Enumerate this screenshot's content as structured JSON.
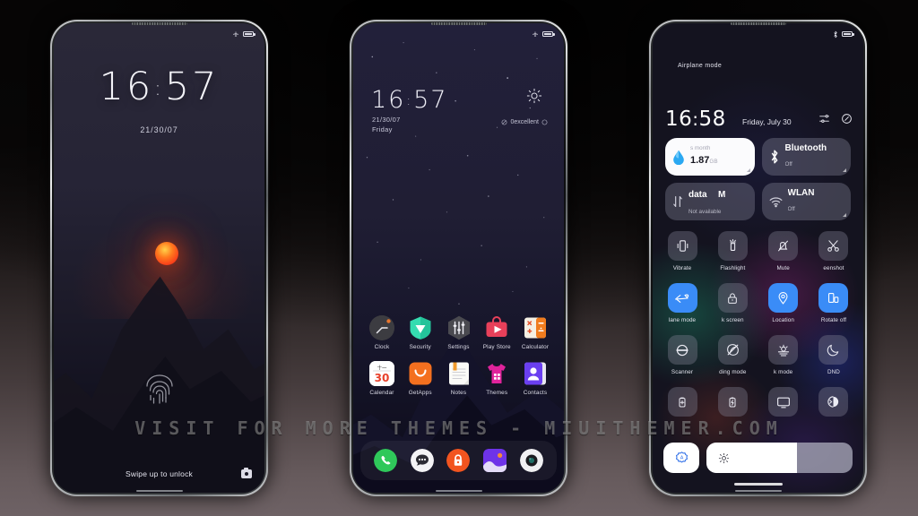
{
  "watermark": "VISIT FOR MORE THEMES - MIUITHEMER.COM",
  "colors": {
    "accent_blue": "#3a8cf7",
    "sun_orange": "#ff5a1e",
    "tile_grey": "#80808f",
    "screen_bg": "#1e1c2b"
  },
  "lock_screen": {
    "status": {
      "battery_icon": "battery-icon",
      "airplane_icon": "airplane-icon"
    },
    "time": "16",
    "time_minutes": "57",
    "time_separator": ":",
    "date": "21/30/07",
    "fingerprint_icon": "fingerprint-icon",
    "swipe_hint": "Swipe up to unlock",
    "camera_icon": "camera-icon"
  },
  "home_screen": {
    "status": {
      "battery_icon": "battery-icon",
      "airplane_icon": "airplane-icon"
    },
    "time": "16",
    "time_minutes": "57",
    "time_separator": ":",
    "date": "21/30/07",
    "weekday": "Friday",
    "weather_icon": "sun-icon",
    "weather_text": "0excellent",
    "apps_row1": [
      {
        "label": "Clock",
        "icon": "clock-icon"
      },
      {
        "label": "Security",
        "icon": "security-shield-icon"
      },
      {
        "label": "Settings",
        "icon": "settings-sliders-icon"
      },
      {
        "label": "Play Store",
        "icon": "play-store-icon"
      },
      {
        "label": "Calculator",
        "icon": "calculator-icon"
      }
    ],
    "apps_row2": [
      {
        "label": "Calendar",
        "icon": "calendar-icon",
        "day": "30",
        "month": "十一"
      },
      {
        "label": "GetApps",
        "icon": "getapps-bag-icon"
      },
      {
        "label": "Notes",
        "icon": "notes-icon"
      },
      {
        "label": "Themes",
        "icon": "themes-shirt-icon"
      },
      {
        "label": "Contacts",
        "icon": "contacts-person-icon"
      }
    ],
    "dock": [
      {
        "label": "Phone",
        "icon": "phone-icon"
      },
      {
        "label": "Messages",
        "icon": "messages-icon"
      },
      {
        "label": "Security Lock",
        "icon": "lock-icon"
      },
      {
        "label": "Gallery",
        "icon": "gallery-icon"
      },
      {
        "label": "Camera",
        "icon": "camera-lens-icon"
      }
    ]
  },
  "control_center": {
    "status_left": "Airplane mode",
    "status": {
      "battery_icon": "battery-icon",
      "bluetooth_icon": "bluetooth-icon"
    },
    "time": "16",
    "time_minutes": "58",
    "time_separator": ":",
    "date": "Friday, July 30",
    "header_icons": [
      {
        "name": "settings-sliders-icon"
      },
      {
        "name": "edit-toggles-icon"
      }
    ],
    "big_tiles": [
      {
        "name": "data-usage-tile",
        "sub": "s month",
        "main": "1.87",
        "unit": "GB",
        "icon": "data-drop-icon",
        "style": "light"
      },
      {
        "name": "bluetooth-tile",
        "main": "Bluetooth",
        "sub": "Off",
        "icon": "bluetooth-icon",
        "style": "dark"
      }
    ],
    "mid_tiles": [
      {
        "name": "mobile-data-tile",
        "main": "data",
        "main_suffix": "M",
        "sub": "Not available",
        "icon": "data-arrows-icon",
        "style": "dark"
      },
      {
        "name": "wlan-tile",
        "main": "WLAN",
        "sub": "Off",
        "icon": "wifi-icon",
        "style": "dark"
      }
    ],
    "toggles": [
      [
        {
          "label": "Vibrate",
          "icon": "vibrate-icon",
          "on": false
        },
        {
          "label": "Flashlight",
          "icon": "flashlight-icon",
          "on": false
        },
        {
          "label": "Mute",
          "icon": "mute-bell-icon",
          "on": false
        },
        {
          "label": "eenshot",
          "icon": "scissors-icon",
          "on": false
        }
      ],
      [
        {
          "label": "lane mode",
          "icon": "airplane-icon",
          "on": true
        },
        {
          "label": "k screen",
          "icon": "lock-icon",
          "on": false
        },
        {
          "label": "Location",
          "icon": "location-pin-icon",
          "on": true
        },
        {
          "label": "Rotate off",
          "icon": "rotate-icon",
          "on": true
        }
      ],
      [
        {
          "label": "Scanner",
          "icon": "scanner-icon",
          "on": false
        },
        {
          "label": "ding mode",
          "icon": "reading-mode-icon",
          "on": false
        },
        {
          "label": "k mode",
          "icon": "sunset-icon",
          "on": false
        },
        {
          "label": "DND",
          "icon": "moon-icon",
          "on": false
        }
      ],
      [
        {
          "label": "",
          "icon": "battery-saver-icon",
          "on": false
        },
        {
          "label": "",
          "icon": "battery-charge-icon",
          "on": false
        },
        {
          "label": "",
          "icon": "cast-screen-icon",
          "on": false
        },
        {
          "label": "",
          "icon": "dark-mode-icon",
          "on": false
        }
      ]
    ],
    "brightness": {
      "auto_icon": "auto-brightness-icon",
      "slider_icon": "brightness-sun-icon",
      "level_percent": 62
    }
  }
}
